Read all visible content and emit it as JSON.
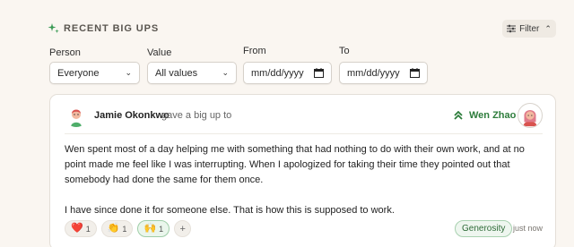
{
  "header": {
    "title": "RECENT BIG UPS",
    "title_icon": "sparkle-icon",
    "filter_label": "Filter",
    "filter_icon": "sliders-icon",
    "filter_chevron": "chevron-up-icon"
  },
  "filters": {
    "person": {
      "label": "Person",
      "value": "Everyone"
    },
    "value": {
      "label": "Value",
      "value": "All values"
    },
    "from": {
      "label": "From",
      "value": "mm/dd/yyyy"
    },
    "to": {
      "label": "To",
      "value": "mm/dd/yyyy"
    }
  },
  "card": {
    "giver": "Jamie Okonkwo",
    "action": "gave a big up to",
    "receiver": "Wen Zhao",
    "message": [
      "Wen spent most of a day helping me with something that had nothing to do with their own work, and at no point made me feel like I was interrupting. When I apologized for taking their time they pointed out that somebody had done the same for them once.",
      "I have since done it for someone else. That is how this is supposed to work."
    ],
    "reactions": [
      {
        "emoji": "❤️",
        "count": "1",
        "active": false
      },
      {
        "emoji": "👏",
        "count": "1",
        "active": false
      },
      {
        "emoji": "🙌",
        "count": "1",
        "active": true
      }
    ],
    "add_reaction": "+",
    "value_tag": "Generosity",
    "timestamp": "just now"
  },
  "colors": {
    "background": "#faf6f1",
    "accent_green": "#2e7d3c",
    "card_bg": "#ffffff"
  }
}
